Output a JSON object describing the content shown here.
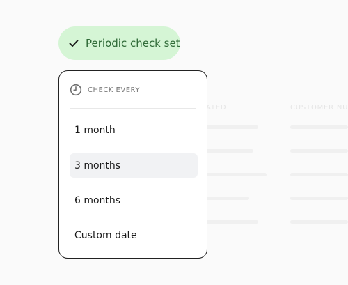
{
  "status_pill": {
    "label": "Periodic check set",
    "icon": "check-icon",
    "background_color": "#d5f5d5",
    "text_color": "#2f6a37"
  },
  "dropdown": {
    "header_label": "CHECK EVERY",
    "header_icon": "clock-icon",
    "options": [
      {
        "label": "1 month",
        "selected": false
      },
      {
        "label": "3 months",
        "selected": true
      },
      {
        "label": "6 months",
        "selected": false
      },
      {
        "label": "Custom date",
        "selected": false
      }
    ]
  },
  "background_table": {
    "column_headers": [
      "ATED",
      "CUSTOMER NUM"
    ]
  }
}
